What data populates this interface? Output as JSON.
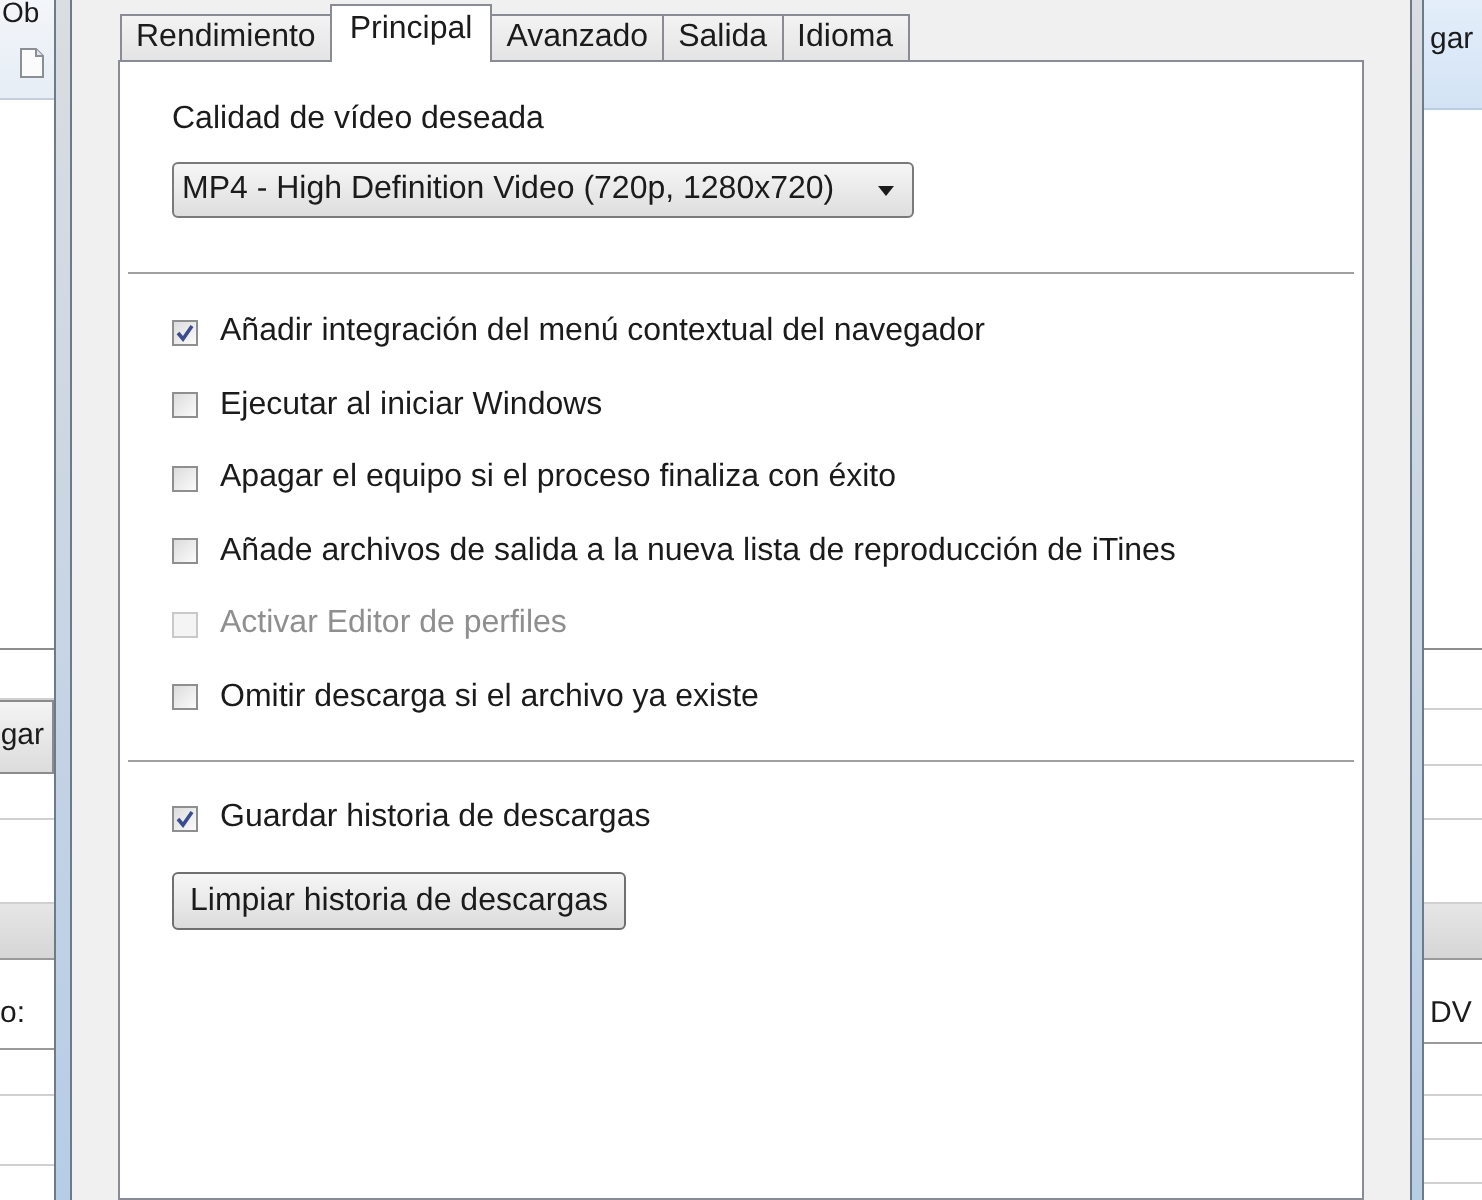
{
  "background_window_left": {
    "toolbar_text": "Ob",
    "button": "gar",
    "field_label": "o:"
  },
  "background_window_right": {
    "toolbar_text": "gar",
    "field_value": "DV"
  },
  "dialog": {
    "tabs": [
      {
        "label": "Rendimiento",
        "selected": false
      },
      {
        "label": "Principal",
        "selected": true
      },
      {
        "label": "Avanzado",
        "selected": false
      },
      {
        "label": "Salida",
        "selected": false
      },
      {
        "label": "Idioma",
        "selected": false
      }
    ],
    "quality": {
      "label": "Calidad de vídeo deseada",
      "value": "MP4 - High Definition Video (720p, 1280x720)"
    },
    "options": [
      {
        "label": "Añadir integración del menú contextual del navegador",
        "checked": true,
        "disabled": false
      },
      {
        "label": "Ejecutar al iniciar Windows",
        "checked": false,
        "disabled": false
      },
      {
        "label": "Apagar el equipo si el proceso finaliza con éxito",
        "checked": false,
        "disabled": false
      },
      {
        "label": "Añade archivos de salida a la nueva lista de reproducción de iTines",
        "checked": false,
        "disabled": false
      },
      {
        "label": "Activar Editor de perfiles",
        "checked": false,
        "disabled": true
      },
      {
        "label": "Omitir descarga si el archivo ya existe",
        "checked": false,
        "disabled": false
      }
    ],
    "history": {
      "option": {
        "label": "Guardar historia de descargas",
        "checked": true,
        "disabled": false
      },
      "button": "Limpiar historia de descargas"
    }
  }
}
